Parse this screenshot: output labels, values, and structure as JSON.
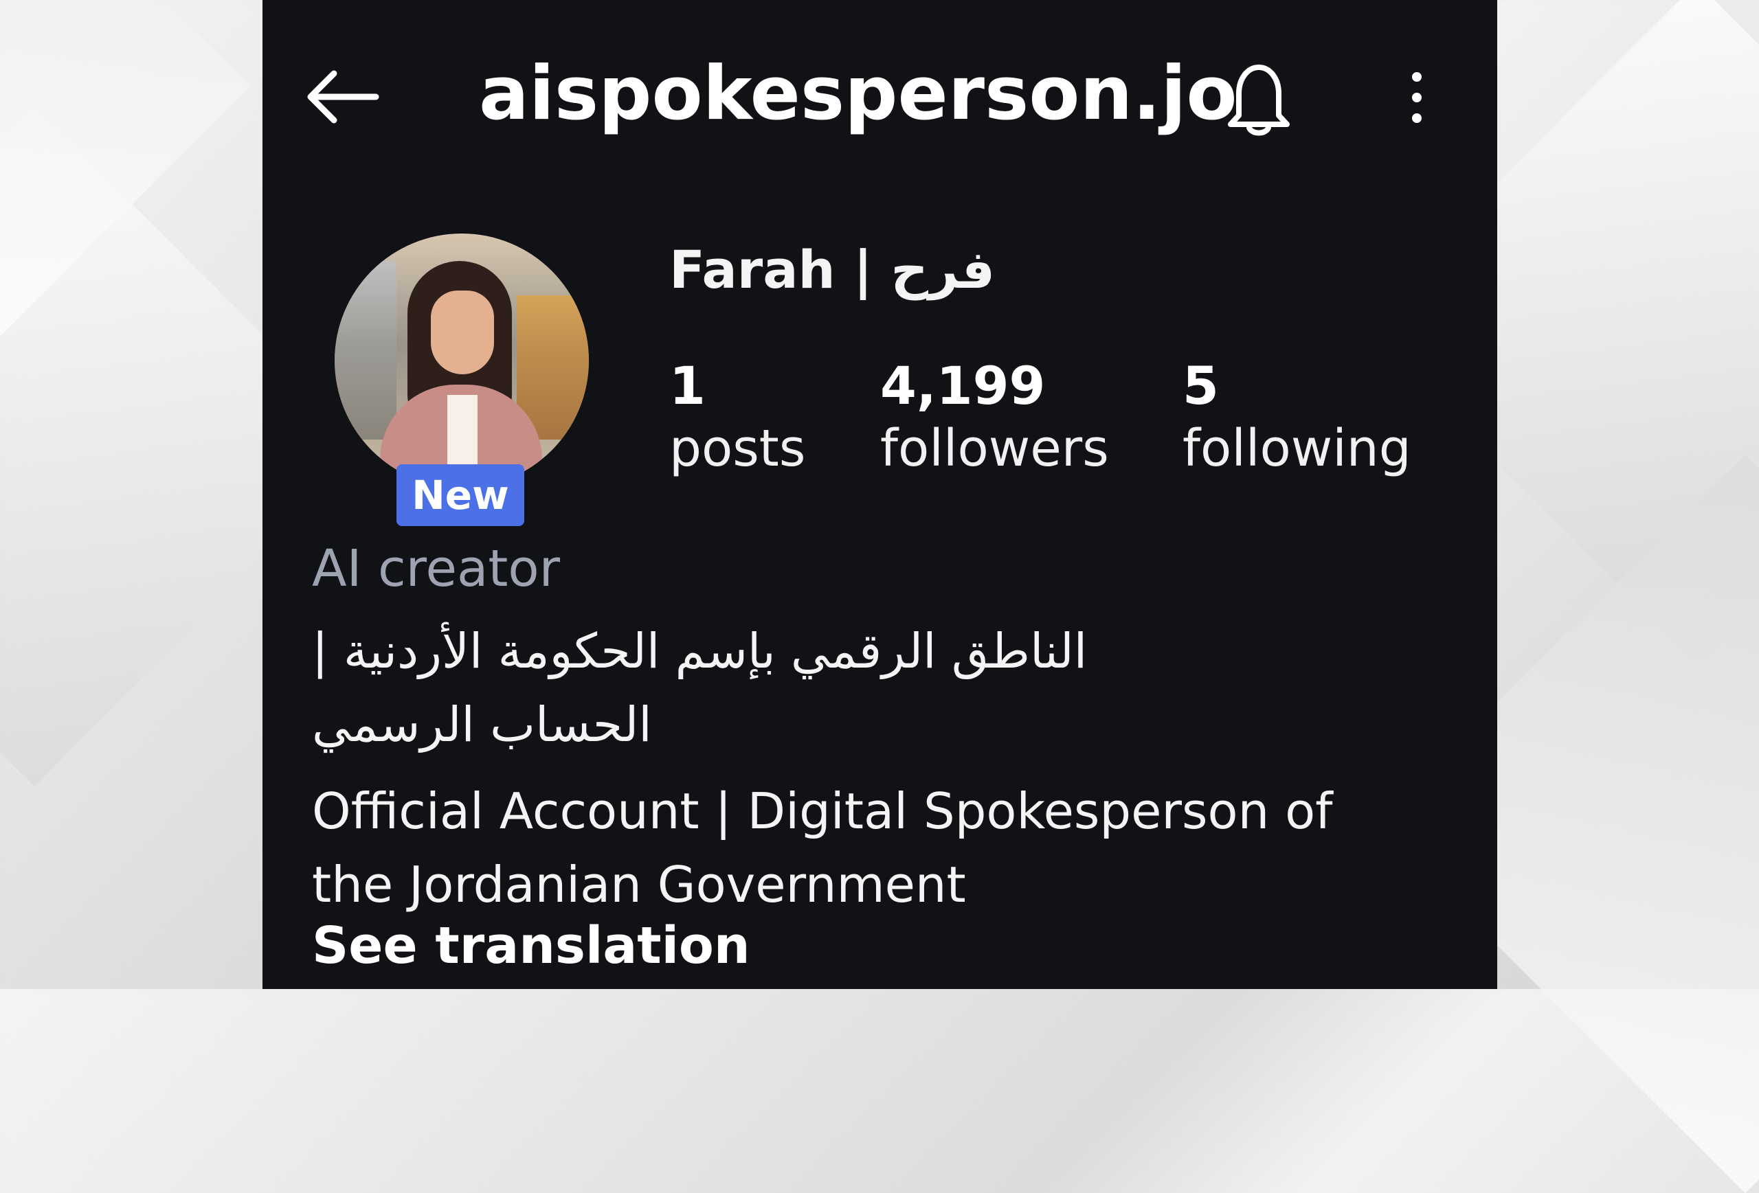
{
  "header": {
    "back_icon": "back-arrow-icon",
    "handle": "aispokesperson.jo",
    "notifications_icon": "bell-icon",
    "more_icon": "more-vertical-icon"
  },
  "profile": {
    "display_name": "Farah | فرح",
    "avatar_badge": "New",
    "stats": {
      "posts": {
        "value": "1",
        "label": "posts"
      },
      "followers": {
        "value": "4,199",
        "label": "followers"
      },
      "following": {
        "value": "5",
        "label": "following"
      }
    },
    "category": "AI creator",
    "bio_arabic": "الناطق الرقمي بإسم الحكومة الأردنية | الحساب الرسمي",
    "bio_english": "Official Account | Digital Spokesperson of the Jordanian Government",
    "see_translation": "See translation"
  },
  "colors": {
    "background": "#101216",
    "text": "#f5f5f5",
    "secondary_text": "#9da3b1",
    "badge": "#4c71e7"
  }
}
